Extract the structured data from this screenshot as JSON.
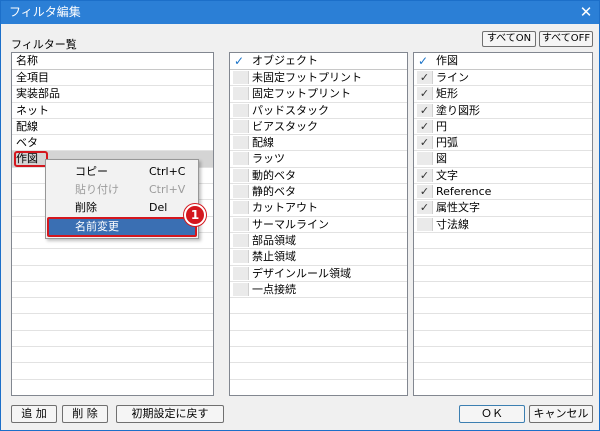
{
  "window": {
    "title": "フィルタ編集",
    "close_glyph": "✕"
  },
  "filter_list": {
    "title": "フィルター覧",
    "header": "名称",
    "items": [
      "全項目",
      "実装部品",
      "ネット",
      "配線",
      "ベタ",
      "作図"
    ]
  },
  "top_buttons": {
    "all_on": "すべてON",
    "all_off": "すべてOFF"
  },
  "object_panel": {
    "header": "オブジェクト",
    "items": [
      {
        "label": "未固定フットプリント",
        "checked": false
      },
      {
        "label": "固定フットプリント",
        "checked": false
      },
      {
        "label": "パッドスタック",
        "checked": false
      },
      {
        "label": "ビアスタック",
        "checked": false
      },
      {
        "label": "配線",
        "checked": false
      },
      {
        "label": "ラッツ",
        "checked": false
      },
      {
        "label": "動的ベタ",
        "checked": false
      },
      {
        "label": "静的ベタ",
        "checked": false
      },
      {
        "label": "カットアウト",
        "checked": false
      },
      {
        "label": "サーマルライン",
        "checked": false
      },
      {
        "label": "部品領域",
        "checked": false
      },
      {
        "label": "禁止領域",
        "checked": false
      },
      {
        "label": "デザインルール領域",
        "checked": false
      },
      {
        "label": "一点接続",
        "checked": false
      }
    ]
  },
  "drawing_panel": {
    "header": "作図",
    "items": [
      {
        "label": "ライン",
        "checked": true
      },
      {
        "label": "矩形",
        "checked": true
      },
      {
        "label": "塗り図形",
        "checked": true
      },
      {
        "label": "円",
        "checked": true
      },
      {
        "label": "円弧",
        "checked": true
      },
      {
        "label": "図",
        "checked": false
      },
      {
        "label": "文字",
        "checked": true
      },
      {
        "label": "Reference",
        "checked": true
      },
      {
        "label": "属性文字",
        "checked": true
      },
      {
        "label": "寸法線",
        "checked": false
      }
    ]
  },
  "context_menu": {
    "items": [
      {
        "label": "コピー",
        "shortcut": "Ctrl+C"
      },
      {
        "label": "貼り付け",
        "shortcut": "Ctrl+V"
      },
      {
        "label": "削除",
        "shortcut": "Del"
      },
      {
        "label": "名前変更",
        "shortcut": ""
      }
    ]
  },
  "callout": {
    "number": "1"
  },
  "bottom_buttons": {
    "add": "追 加",
    "delete": "削 除",
    "reset": "初期設定に戻す",
    "ok": "ＯＫ",
    "cancel": "キャンセル"
  },
  "icons": {
    "check": "✓"
  },
  "colors": {
    "titlebar": "#2b7fd6",
    "callout": "#d4171e",
    "menu_active": "#3a6fb3",
    "check_header": "#1a73c8"
  }
}
